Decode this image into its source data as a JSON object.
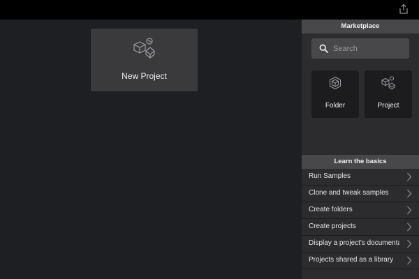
{
  "topbar": {
    "share_icon": "share-icon"
  },
  "workspace": {
    "new_project_label": "New Project",
    "new_project_icon": "project-shapes-icon"
  },
  "sidebar": {
    "marketplace_title": "Marketplace",
    "search": {
      "placeholder": "Search",
      "value": ""
    },
    "cards": [
      {
        "label": "Folder",
        "icon": "folder-cube-icon"
      },
      {
        "label": "Project",
        "icon": "project-shapes-icon"
      }
    ],
    "basics_title": "Learn the basics",
    "basics_items": [
      {
        "label": "Run Samples"
      },
      {
        "label": "Clone and tweak samples"
      },
      {
        "label": "Create folders"
      },
      {
        "label": "Create projects"
      },
      {
        "label": "Display a project's documentati"
      },
      {
        "label": "Projects shared as a library"
      }
    ]
  },
  "colors": {
    "topbar": "#000000",
    "workspace": "#1e1f22",
    "sidebar": "#2c2c2e",
    "header": "#48484a",
    "tile": "#3a3a3c",
    "card": "#1c1c1e"
  }
}
